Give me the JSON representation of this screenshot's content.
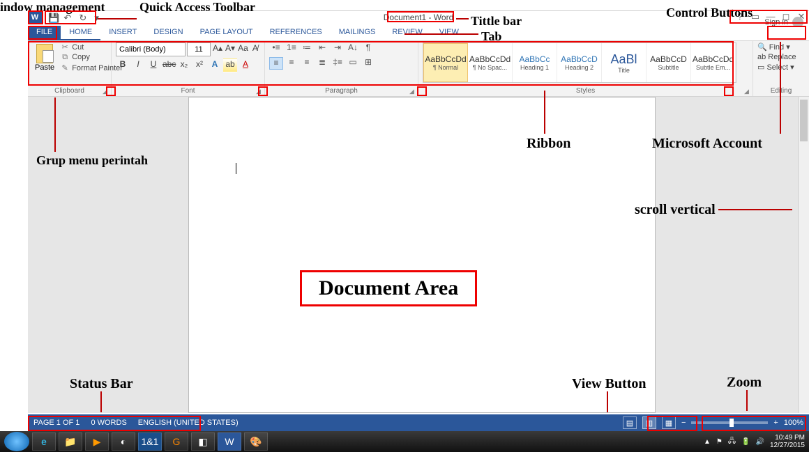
{
  "annotations": {
    "window_mgmt": "indow management",
    "qat": "Quick Access Toolbar",
    "title_bar": "Tittle bar",
    "control_buttons": "Control Buttons",
    "tab": "Tab",
    "ribbon": "Ribbon",
    "ms_account": "Microsoft Account",
    "grup_menu": "Grup menu perintah",
    "scroll_v": "scroll vertical",
    "doc_area": "Document Area",
    "status_bar": "Status Bar",
    "view_button": "View Button",
    "zoom": "Zoom"
  },
  "title": "Document1 - Word",
  "signin": "Sign in",
  "tabs": [
    "FILE",
    "HOME",
    "INSERT",
    "DESIGN",
    "PAGE LAYOUT",
    "REFERENCES",
    "MAILINGS",
    "REVIEW",
    "VIEW"
  ],
  "active_tab": "HOME",
  "clipboard": {
    "label": "Clipboard",
    "paste": "Paste",
    "cut": "Cut",
    "copy": "Copy",
    "format_painter": "Format Painter"
  },
  "font": {
    "label": "Font",
    "name": "Calibri (Body)",
    "size": "11"
  },
  "paragraph": {
    "label": "Paragraph"
  },
  "styles": {
    "label": "Styles",
    "items": [
      {
        "preview": "AaBbCcDd",
        "name": "¶ Normal"
      },
      {
        "preview": "AaBbCcDd",
        "name": "¶ No Spac..."
      },
      {
        "preview": "AaBbCc",
        "name": "Heading 1"
      },
      {
        "preview": "AaBbCcD",
        "name": "Heading 2"
      },
      {
        "preview": "AaBl",
        "name": "Title"
      },
      {
        "preview": "AaBbCcD",
        "name": "Subtitle"
      },
      {
        "preview": "AaBbCcDd",
        "name": "Subtle Em..."
      }
    ]
  },
  "editing": {
    "label": "Editing",
    "find": "Find",
    "replace": "Replace",
    "select": "Select"
  },
  "status": {
    "page": "PAGE 1 OF 1",
    "words": "0 WORDS",
    "lang": "ENGLISH (UNITED STATES)",
    "zoom": "100%"
  },
  "tray": {
    "time": "10:49 PM",
    "date": "12/27/2015"
  }
}
